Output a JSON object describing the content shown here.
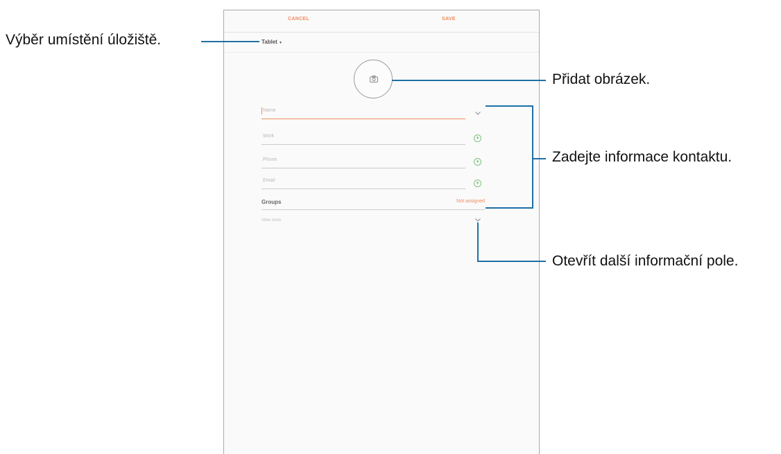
{
  "topbar": {
    "cancel_label": "CANCEL",
    "save_label": "SAVE"
  },
  "storage": {
    "label": "Tablet",
    "caret": "▾"
  },
  "form": {
    "name_placeholder": "Name",
    "work_placeholder": "Work",
    "phone_placeholder": "Phone",
    "email_placeholder": "Email",
    "groups_label": "Groups",
    "groups_value": "Not assigned",
    "view_more_label": "View more"
  },
  "callouts": {
    "storage": "Výběr umístění úložiště.",
    "picture": "Přidat obrázek.",
    "contact_info": "Zadejte informace kontaktu.",
    "more_fields": "Otevřít další informační pole."
  },
  "colors": {
    "accent": "#f08a5d",
    "callout_line": "#1d6fa5",
    "add_icon": "#4fae4d"
  }
}
